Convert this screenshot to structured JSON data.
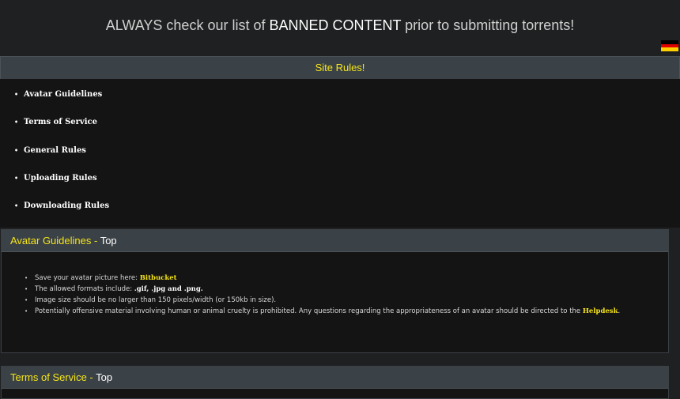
{
  "banner": {
    "prefix": "ALWAYS check our list of ",
    "emphasis": "BANNED CONTENT",
    "suffix": " prior to submitting torrents!"
  },
  "flag": {
    "icon": "german-flag",
    "colors": [
      "#000000",
      "#dd0000",
      "#ffce00"
    ]
  },
  "rules": {
    "title": "Site Rules!",
    "items": [
      {
        "label": "Avatar Guidelines"
      },
      {
        "label": "Terms of Service"
      },
      {
        "label": "General Rules"
      },
      {
        "label": "Uploading Rules"
      },
      {
        "label": "Downloading Rules"
      }
    ]
  },
  "avatar": {
    "title": "Avatar Guidelines",
    "separator": " - ",
    "top_label": "Top",
    "line1_text": "Save your avatar picture here: ",
    "line1_link": "Bitbucket",
    "line2_text": "The allowed formats include: ",
    "line2_formats": ".gif, .jpg and .png.",
    "line3_text": "Image size should be no larger than 150 pixels/width (or 150kb in size).",
    "line4_text": "Potentially offensive material involving human or animal cruelty is prohibited. Any questions regarding the appropriateness of an avatar should be directed to the ",
    "line4_link": "Helpdesk",
    "line4_end": "."
  },
  "tos": {
    "title": "Terms of Service",
    "separator": " - ",
    "top_label": "Top"
  },
  "colors": {
    "background": "#1f2021",
    "header_bg": "#3a4147",
    "accent_yellow": "#f7e617",
    "panel_bg": "#141414"
  }
}
